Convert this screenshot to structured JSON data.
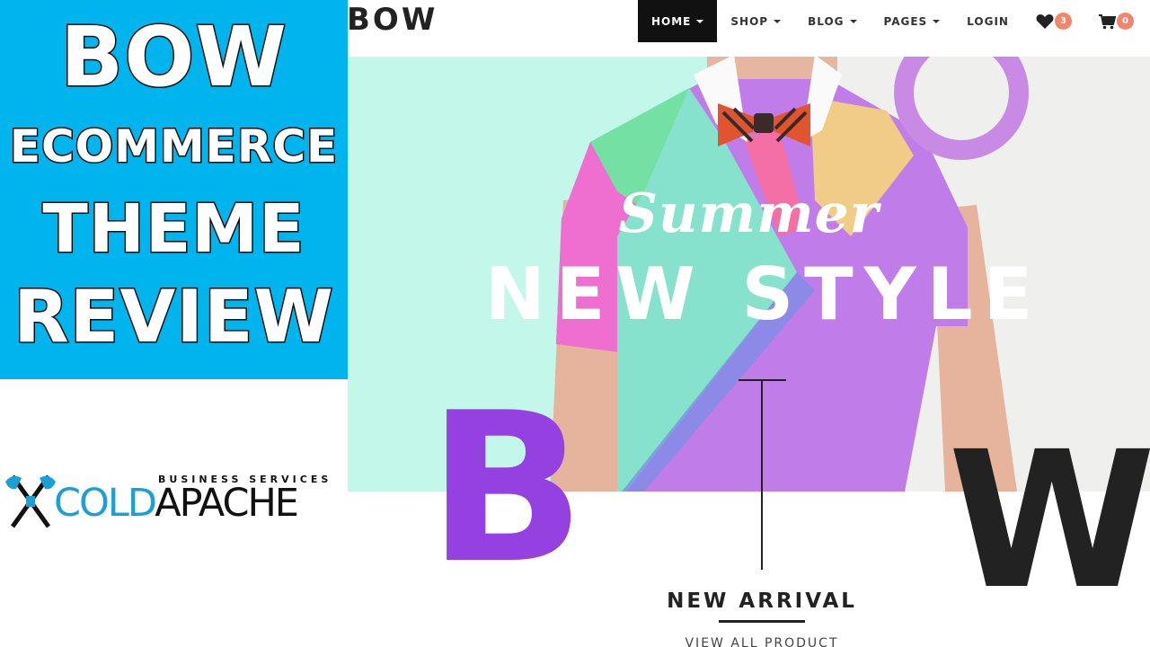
{
  "thumbnail": {
    "lines": [
      "BOW",
      "ECOMMERCE",
      "THEME",
      "REVIEW"
    ],
    "background_color": "#00b5ee"
  },
  "coldapache_logo": {
    "icon": "crossed-axes-icon",
    "subtitle": "BUSINESS SERVICES",
    "word_cold": "COLD",
    "word_apache": "APACHE",
    "colors": {
      "cold": "#1a9fd6",
      "apache": "#111111"
    }
  },
  "header": {
    "site_logo": "BOW",
    "nav": {
      "home": "HOME",
      "shop": "SHOP",
      "blog": "BLOG",
      "pages": "PAGES",
      "login": "LOGIN"
    },
    "wishlist": {
      "icon": "heart-icon",
      "count": "3"
    },
    "cart": {
      "icon": "cart-icon",
      "count": "0"
    },
    "badge_color": "#f2856b"
  },
  "hero": {
    "script_text": "Summer",
    "headline": "NEW STYLE",
    "accent_colors": {
      "mint": "#c2f7ea",
      "purple": "#c17de8",
      "green": "#74e0a4",
      "teal": "#86e2cc",
      "pink": "#ee6fd0",
      "yellow": "#f0cc86",
      "ring": "#c98ae6"
    }
  },
  "decor": {
    "big_letter_left": "B",
    "big_letter_right": "W",
    "big_letter_left_color": "#9540e0"
  },
  "arrival": {
    "title": "NEW ARRIVAL",
    "view_all": "VIEW ALL PRODUCT"
  }
}
